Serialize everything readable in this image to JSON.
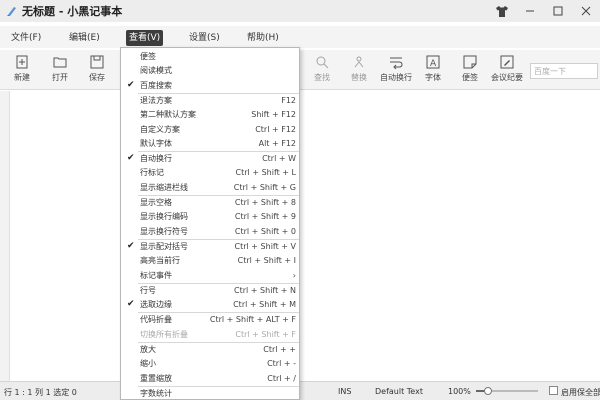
{
  "titlebar": {
    "title": "无标题 - 小黑记事本"
  },
  "menubar": {
    "items": [
      "文件(F)",
      "编辑(E)",
      "查看(V)",
      "设置(S)",
      "帮助(H)"
    ]
  },
  "toolbar": {
    "left": [
      "新建",
      "打开",
      "保存"
    ],
    "right": [
      "查找",
      "替换",
      "自动换行",
      "字体",
      "便签",
      "会议纪要"
    ],
    "search_placeholder": "百度一下"
  },
  "view_menu": {
    "items": [
      {
        "label": "便签",
        "shortcut": "",
        "checked": false
      },
      {
        "label": "阅读模式",
        "shortcut": "",
        "checked": false
      },
      {
        "label": "百度搜索",
        "shortcut": "",
        "checked": true
      },
      {
        "label": "退法方案",
        "shortcut": "F12",
        "checked": false
      },
      {
        "label": "第二种默认方案",
        "shortcut": "Shift + F12",
        "checked": false
      },
      {
        "label": "自定义方案",
        "shortcut": "Ctrl + F12",
        "checked": false
      },
      {
        "label": "默认字体",
        "shortcut": "Alt + F12",
        "checked": false
      },
      {
        "label": "自动换行",
        "shortcut": "Ctrl + W",
        "checked": true
      },
      {
        "label": "行标记",
        "shortcut": "Ctrl + Shift + L",
        "checked": false
      },
      {
        "label": "显示缩进栏线",
        "shortcut": "Ctrl + Shift + G",
        "checked": false
      },
      {
        "label": "显示空格",
        "shortcut": "Ctrl + Shift + 8",
        "checked": false
      },
      {
        "label": "显示换行编码",
        "shortcut": "Ctrl + Shift + 9",
        "checked": false
      },
      {
        "label": "显示换行符号",
        "shortcut": "Ctrl + Shift + 0",
        "checked": false
      },
      {
        "label": "显示配对括号",
        "shortcut": "Ctrl + Shift + V",
        "checked": true
      },
      {
        "label": "高亮当前行",
        "shortcut": "Ctrl + Shift + I",
        "checked": false
      },
      {
        "label": "标记事件",
        "shortcut": "›",
        "checked": false
      },
      {
        "label": "行号",
        "shortcut": "Ctrl + Shift + N",
        "checked": false
      },
      {
        "label": "选取边缘",
        "shortcut": "Ctrl + Shift + M",
        "checked": true
      },
      {
        "label": "代码折叠",
        "shortcut": "Ctrl + Shift + ALT + F",
        "checked": false
      },
      {
        "label": "切换所有折叠",
        "shortcut": "Ctrl + Shift + F",
        "checked": false,
        "disabled": true
      },
      {
        "label": "放大",
        "shortcut": "Ctrl + +",
        "checked": false
      },
      {
        "label": "缩小",
        "shortcut": "Ctrl + -",
        "checked": false
      },
      {
        "label": "重置缩放",
        "shortcut": "Ctrl + /",
        "checked": false
      },
      {
        "label": "字数统计",
        "shortcut": "",
        "checked": false
      }
    ]
  },
  "statusbar": {
    "position": "行 1 : 1   列 1   选定 0",
    "mode": "INS",
    "syntax": "Default Text",
    "zoom": "100%",
    "zoom_level": 0.2,
    "option_label": "启用保全部"
  },
  "colors": {
    "menu_active_bg": "#3d3d3d",
    "background": "#f4f4f4"
  }
}
